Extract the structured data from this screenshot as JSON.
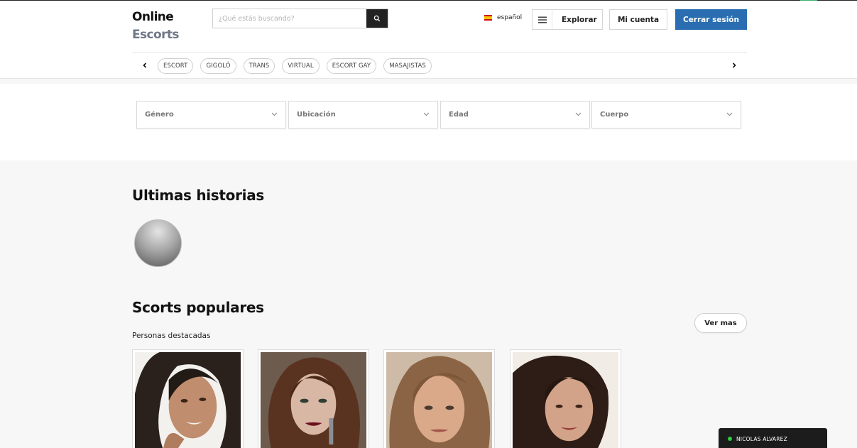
{
  "brand": {
    "line1": "Online",
    "line2": "Escorts"
  },
  "search": {
    "placeholder": "¿Qué estás buscando?",
    "value": ""
  },
  "language": {
    "label": "español",
    "flag": "spain-flag-icon"
  },
  "nav": {
    "explore_label": "Explorar",
    "account_label": "Mi cuenta",
    "logout_label": "Cerrar sesión",
    "logout_color": "#2a6db0"
  },
  "categories": [
    "ESCORT",
    "GIGOLÓ",
    "TRANS",
    "VIRTUAL",
    "ESCORT GAY",
    "MASAJISTAS"
  ],
  "filters": [
    "Género",
    "Ubicación",
    "Edad",
    "Cuerpo"
  ],
  "stories": {
    "title": "Ultimas historias"
  },
  "popular": {
    "title": "Scorts populares",
    "subtitle": "Personas destacadas",
    "see_more_label": "Ver mas"
  },
  "chat": {
    "user_name": "NICOLAS ALVAREZ",
    "status_color": "#2ecc40"
  }
}
